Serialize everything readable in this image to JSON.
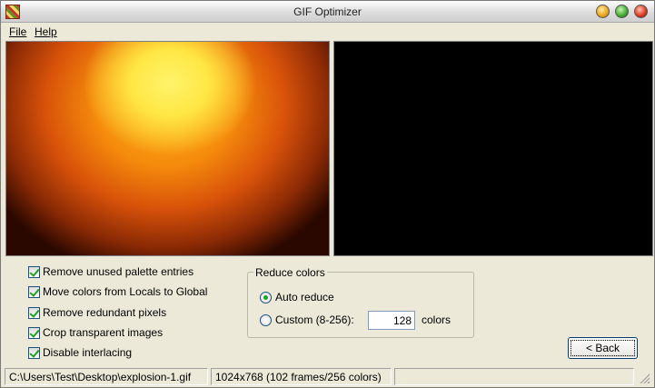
{
  "window": {
    "title": "GIF Optimizer"
  },
  "menu": {
    "file": "File",
    "help": "Help"
  },
  "options": [
    {
      "label": "Remove unused palette entries",
      "checked": true
    },
    {
      "label": "Move colors from Locals to Global",
      "checked": true
    },
    {
      "label": "Remove redundant pixels",
      "checked": true
    },
    {
      "label": "Crop transparent images",
      "checked": true
    },
    {
      "label": "Disable interlacing",
      "checked": true
    }
  ],
  "reduce": {
    "title": "Reduce colors",
    "auto_label": "Auto reduce",
    "custom_label": "Custom (8-256):",
    "custom_value": "128",
    "unit": "colors",
    "selected": "auto"
  },
  "buttons": {
    "back": "< Back"
  },
  "status": {
    "path": "C:\\Users\\Test\\Desktop\\explosion-1.gif",
    "info": "1024x768 (102 frames/256 colors)",
    "extra": ""
  }
}
